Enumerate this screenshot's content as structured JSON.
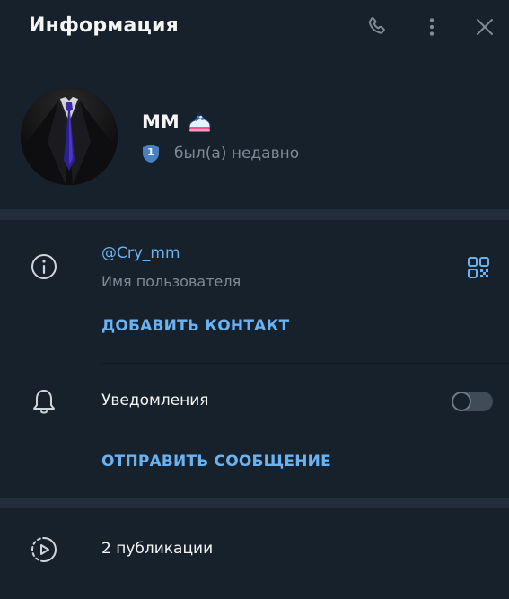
{
  "header": {
    "title": "Информация"
  },
  "profile": {
    "name": "ММ",
    "status": "был(а) недавно",
    "badge_number": "1"
  },
  "info": {
    "username": "@Cry_mm",
    "username_caption": "Имя пользователя",
    "add_contact_label": "ДОБАВИТЬ КОНТАКТ"
  },
  "notifications": {
    "label": "Уведомления",
    "enabled": false,
    "send_message_label": "ОТПРАВИТЬ СООБЩЕНИЕ"
  },
  "posts": {
    "label": "2 публикации"
  },
  "colors": {
    "background": "#17212b",
    "separator": "#232e3c",
    "accent": "#6ab3f3",
    "text": "#f5f5f5",
    "muted": "#7e8a97"
  }
}
